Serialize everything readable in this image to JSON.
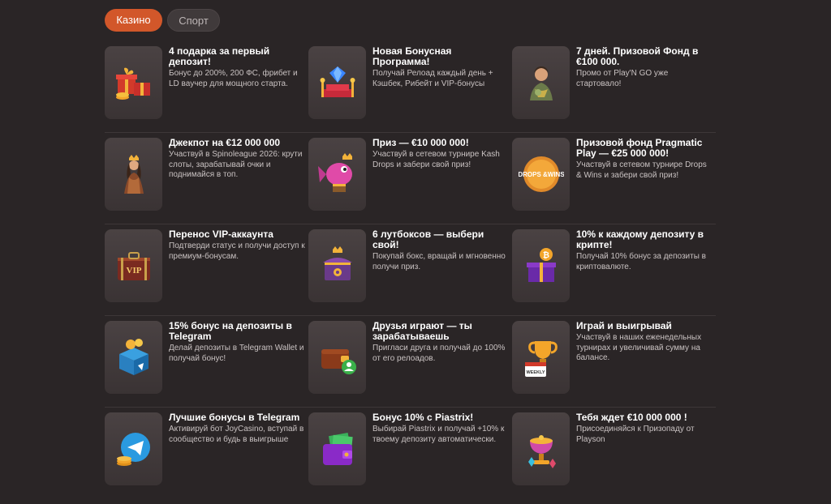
{
  "tabs": {
    "casino": "Казино",
    "sport": "Спорт"
  },
  "colors": {
    "background": "#2a2526",
    "accent": "#d2572a",
    "card_bg": "#3f3839"
  },
  "promos": [
    {
      "title": "4 подарка за первый депозит!",
      "desc": "Бонус до 200%, 200 ФС, фрибет и LD ваучер для мощного старта.",
      "icon": "gift-boxes-icon"
    },
    {
      "title": "Новая Бонусная Программа!",
      "desc": "Получай Релоад каждый день + Кэшбек, Рибейт и VIP-бонусы",
      "icon": "diamond-podium-icon"
    },
    {
      "title": "7 дней. Призовой Фонд в €100 000.",
      "desc": "Промо от Play'N GO уже стартовало!",
      "icon": "adventurer-icon"
    },
    {
      "title": "Джекпот на €12 000 000",
      "desc": "Участвуй в Spinoleague 2026: крути слоты, зарабатывай очки и поднимайся в топ.",
      "icon": "queen-figure-icon"
    },
    {
      "title": "Приз — €10 000 000!",
      "desc": "Участвуй в сетевом турнире Kash Drops и забери свой приз!",
      "icon": "pink-fish-icon"
    },
    {
      "title": "Призовой фонд Pragmatic Play — €25 000 000!",
      "desc": "Участвуй в сетевом турнире Drops & Wins и забери свой приз!",
      "icon": "drops-wins-coin-icon",
      "coin_text": "DROPS &WINS"
    },
    {
      "title": "Перенос VIP-аккаунта",
      "desc": "Подтверди статус и получи доступ к премиум-бонусам.",
      "icon": "vip-suitcase-icon",
      "badge_text": "VIP"
    },
    {
      "title": "6 лутбоксов — выбери свой!",
      "desc": "Покупай бокс, вращай и мгновенно получи приз.",
      "icon": "loot-box-icon"
    },
    {
      "title": "10% к каждому депозиту в крипте!",
      "desc": "Получай 10% бонус за депозиты в криптовалюте.",
      "icon": "crypto-gift-icon"
    },
    {
      "title": "15% бонус на депозиты в Telegram",
      "desc": "Делай депозиты в Telegram Wallet и получай бонус!",
      "icon": "telegram-wallet-box-icon"
    },
    {
      "title": "Друзья играют — ты зарабатываешь",
      "desc": "Пригласи друга и получай до 100% от его релоадов.",
      "icon": "wallet-friends-icon"
    },
    {
      "title": "Играй и выигрывай",
      "desc": "Участвуй в наших еженедельных турнирах и увеличивай сумму на балансе.",
      "icon": "trophy-calendar-icon",
      "calendar_text": "WEEKLY"
    },
    {
      "title": "Лучшие бонусы в Telegram",
      "desc": "Активируй бот JoyCasino, вступай в сообщество и будь в выигрыше",
      "icon": "telegram-coins-icon"
    },
    {
      "title": "Бонус 10% с Piastrix!",
      "desc": "Выбирай Piastrix и получай +10% к твоему депозиту автоматически.",
      "icon": "purple-wallet-icon"
    },
    {
      "title": "Тебя ждет €10 000 000 !",
      "desc": "Присоединяйся к Призопаду от Playson",
      "icon": "treasure-cup-icon"
    }
  ]
}
